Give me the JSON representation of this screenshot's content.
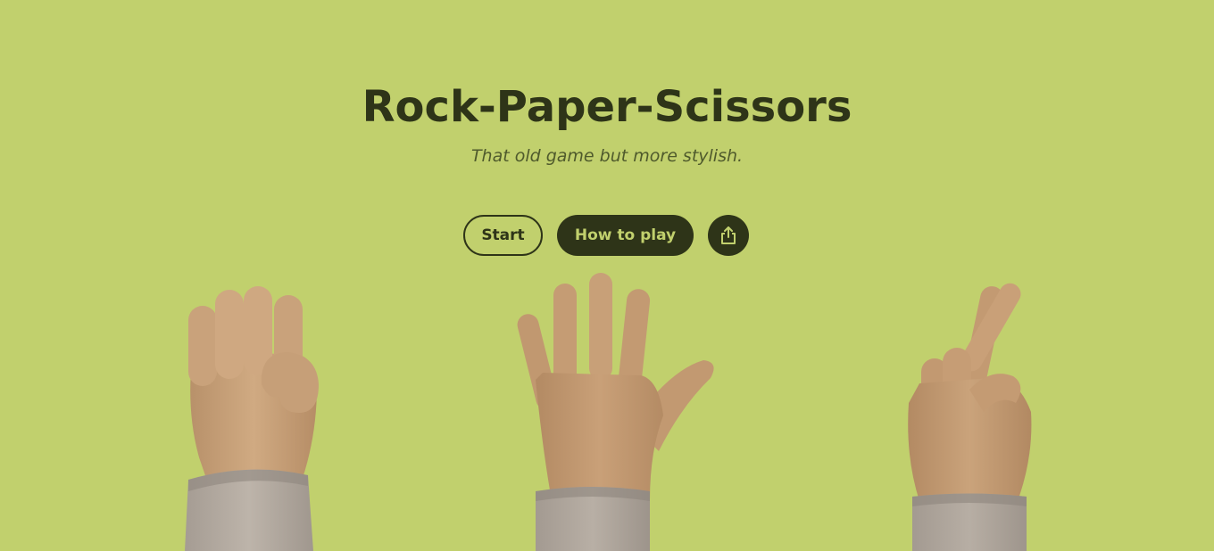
{
  "header": {
    "title": "Rock-Paper-Scissors",
    "subtitle": "That old game but more stylish."
  },
  "actions": {
    "start_label": "Start",
    "how_to_play_label": "How to play",
    "share_icon": "share-icon"
  },
  "hands": [
    {
      "name": "rock-hand",
      "gesture": "rock"
    },
    {
      "name": "paper-hand",
      "gesture": "paper"
    },
    {
      "name": "scissors-hand",
      "gesture": "scissors"
    }
  ],
  "colors": {
    "background": "#c1d06d",
    "primary_dark": "#2e3418",
    "subtitle": "#4f5a2c",
    "skin": "#cba37c",
    "skin_shadow": "#b38a63",
    "sleeve": "#b5aca2"
  }
}
